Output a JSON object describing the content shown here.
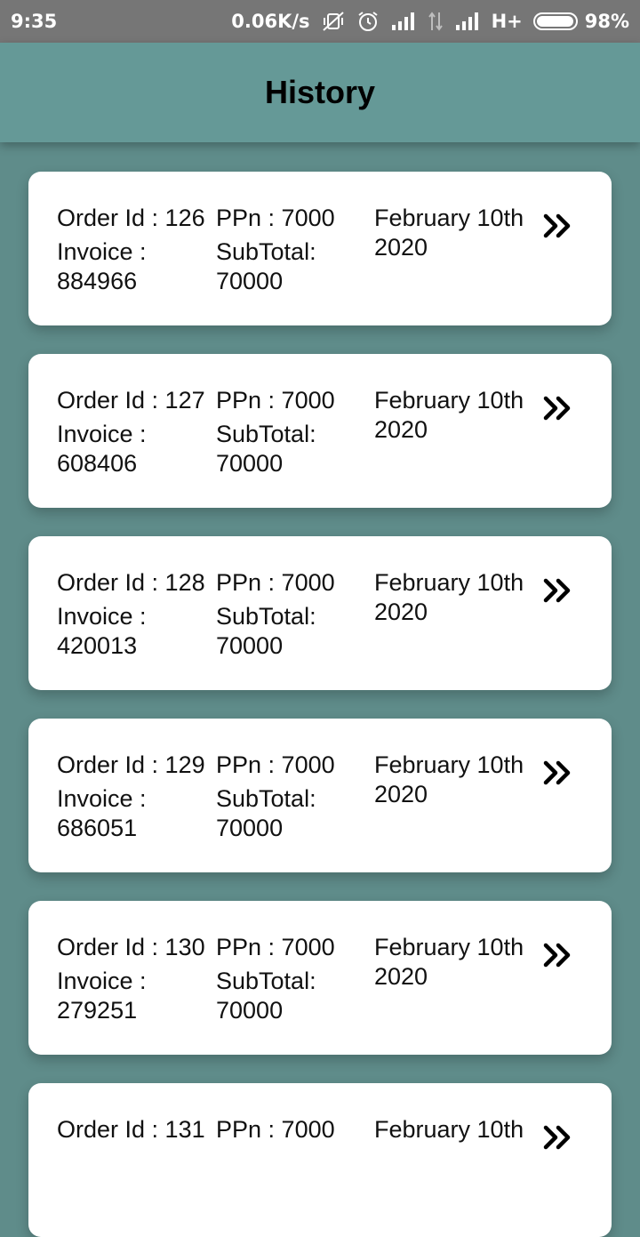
{
  "status_bar": {
    "time": "9:35",
    "speed": "0.06K/s",
    "network_type": "H+",
    "battery": "98%",
    "battery_level": 0.98
  },
  "app_bar": {
    "title": "History"
  },
  "labels": {
    "order_id": "Order Id : ",
    "ppn": "PPn : ",
    "invoice": "Invoice :",
    "subtotal": "SubTotal:"
  },
  "orders": [
    {
      "order_id": "126",
      "ppn": "7000",
      "invoice": "884966",
      "subtotal": "70000",
      "date": "February 10th",
      "year": "2020"
    },
    {
      "order_id": "127",
      "ppn": "7000",
      "invoice": "608406",
      "subtotal": "70000",
      "date": "February 10th",
      "year": "2020"
    },
    {
      "order_id": "128",
      "ppn": "7000",
      "invoice": "420013",
      "subtotal": "70000",
      "date": "February 10th",
      "year": "2020"
    },
    {
      "order_id": "129",
      "ppn": "7000",
      "invoice": "686051",
      "subtotal": "70000",
      "date": "February 10th",
      "year": "2020"
    },
    {
      "order_id": "130",
      "ppn": "7000",
      "invoice": "279251",
      "subtotal": "70000",
      "date": "February 10th",
      "year": "2020"
    },
    {
      "order_id": "131",
      "ppn": "7000",
      "invoice": "",
      "subtotal": "",
      "date": "February 10th",
      "year": ""
    }
  ],
  "colors": {
    "status_bar": "#767676",
    "app_bar": "#659997",
    "background": "#5f8c8a",
    "card": "#ffffff"
  },
  "icons": {
    "detail_chevron": "double-chevron-right-icon"
  }
}
